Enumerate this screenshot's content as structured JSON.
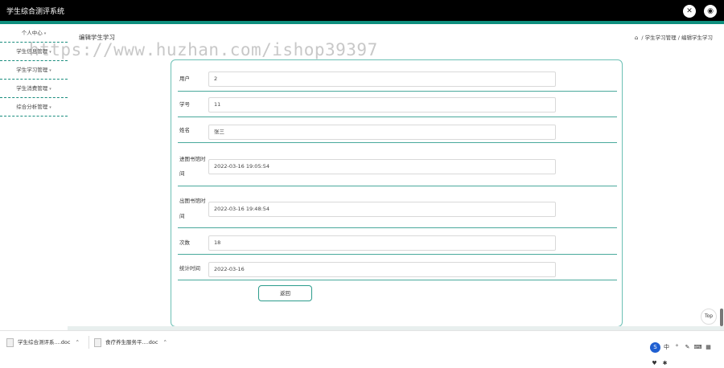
{
  "app": {
    "title": "学生综合测评系统"
  },
  "topbar": {
    "tools_icon": "tools-icon",
    "user_icon": "user-icon"
  },
  "sidebar": {
    "items": [
      {
        "label": "个人中心"
      },
      {
        "label": "学生信息管理"
      },
      {
        "label": "学生学习管理"
      },
      {
        "label": "学生消费管理"
      },
      {
        "label": "综合分析管理"
      }
    ]
  },
  "page": {
    "title": "编辑学生学习"
  },
  "breadcrumb": {
    "items": [
      "学生学习管理",
      "编辑学生学习"
    ],
    "separator": "/"
  },
  "watermark": "https://www.huzhan.com/ishop39397",
  "form": {
    "fields": [
      {
        "label": "用户",
        "value": "2"
      },
      {
        "label": "学号",
        "value": "11"
      },
      {
        "label": "姓名",
        "value": "张三"
      },
      {
        "label_line1": "进图书馆时",
        "label_line2": "间",
        "value": "2022-03-16 19:05:54"
      },
      {
        "label_line1": "出图书馆时",
        "label_line2": "间",
        "value": "2022-03-16 19:48:54"
      },
      {
        "label": "次数",
        "value": "18"
      },
      {
        "label": "统计时间",
        "value": "2022-03-16"
      }
    ],
    "back_label": "返回"
  },
  "top_button": "Top",
  "downloads": [
    {
      "name": "学生综合测评系....doc"
    },
    {
      "name": "食疗养生服务平....doc"
    }
  ],
  "colors": {
    "accent": "#0f8f7e",
    "topbar": "#000000"
  }
}
